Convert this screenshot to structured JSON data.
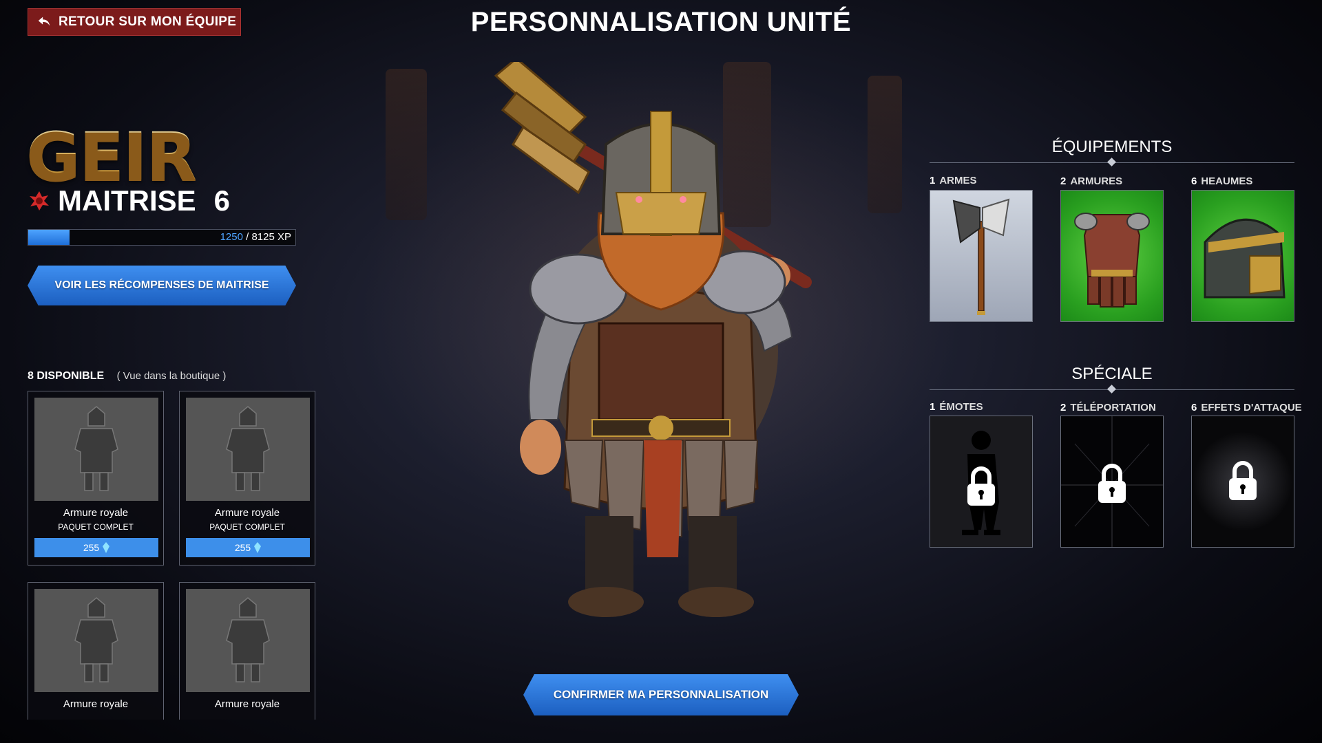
{
  "header": {
    "back_label": "RETOUR SUR MON ÉQUIPE",
    "title": "PERSONNALISATION UNITÉ"
  },
  "unit": {
    "name": "GEIR",
    "mastery_label": "MAITRISE",
    "mastery_level": "6",
    "xp_current": "1250",
    "xp_total": "/ 8125 XP",
    "xp_progress": 0.154
  },
  "rewards_button": "VOIR LES RÉCOMPENSES DE MAITRISE",
  "available": {
    "count": "8",
    "label": "DISPONIBLE",
    "note": "( Vue dans la boutique )",
    "items": [
      {
        "name": "Armure royale",
        "sub": "PAQUET COMPLET",
        "price": "255"
      },
      {
        "name": "Armure royale",
        "sub": "PAQUET COMPLET",
        "price": "255"
      },
      {
        "name": "Armure royale",
        "sub": "",
        "price": ""
      },
      {
        "name": "Armure royale",
        "sub": "",
        "price": ""
      }
    ]
  },
  "equipment": {
    "title": "ÉQUIPEMENTS",
    "slots": [
      {
        "count": "1",
        "label": "ARMES",
        "icon": "axe-icon"
      },
      {
        "count": "2",
        "label": "ARMURES",
        "icon": "armor-icon"
      },
      {
        "count": "6",
        "label": "HEAUMES",
        "icon": "helmet-icon"
      }
    ]
  },
  "special": {
    "title": "SPÉCIALE",
    "slots": [
      {
        "count": "1",
        "label": "ÉMOTES",
        "icon": "lock-icon"
      },
      {
        "count": "2",
        "label": "TÉLÉPORTATION",
        "icon": "lock-icon"
      },
      {
        "count": "6",
        "label": "EFFETS D'ATTAQUE",
        "icon": "lock-icon"
      }
    ]
  },
  "confirm_button": "CONFIRMER MA PERSONNALISATION",
  "colors": {
    "accent_blue": "#3d8fea",
    "back_red": "#7c1b1b",
    "gold": "#e6b84a",
    "green_slot": "#2aa020"
  }
}
